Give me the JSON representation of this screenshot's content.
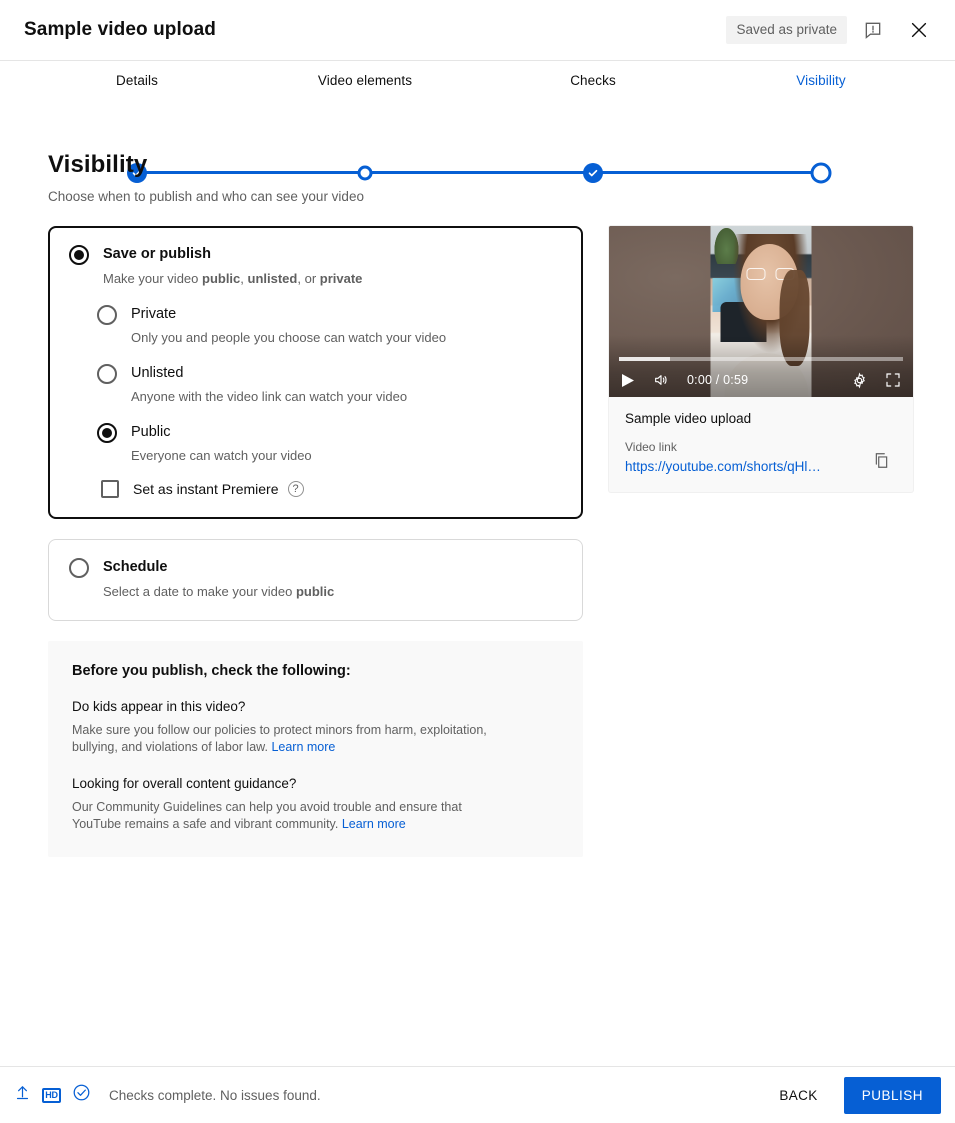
{
  "header": {
    "title": "Sample video upload",
    "status_badge": "Saved as private",
    "feedback_icon": "feedback-exclamation-icon",
    "close_icon": "close-icon"
  },
  "stepper": {
    "steps": [
      {
        "label": "Details",
        "state": "done"
      },
      {
        "label": "Video elements",
        "state": "todo"
      },
      {
        "label": "Checks",
        "state": "done"
      },
      {
        "label": "Visibility",
        "state": "current"
      }
    ],
    "accent_color": "#065fd4"
  },
  "page": {
    "title": "Visibility",
    "subtitle": "Choose when to publish and who can see your video"
  },
  "save_or_publish": {
    "title": "Save or publish",
    "desc_prefix": "Make your video ",
    "desc_b1": "public",
    "desc_mid1": ", ",
    "desc_b2": "unlisted",
    "desc_mid2": ", or ",
    "desc_b3": "private",
    "selected": true,
    "options": [
      {
        "label": "Private",
        "desc": "Only you and people you choose can watch your video",
        "selected": false
      },
      {
        "label": "Unlisted",
        "desc": "Anyone with the video link can watch your video",
        "selected": false
      },
      {
        "label": "Public",
        "desc": "Everyone can watch your video",
        "selected": true
      }
    ],
    "premiere": {
      "label": "Set as instant Premiere",
      "checked": false,
      "help_glyph": "?"
    }
  },
  "schedule": {
    "title": "Schedule",
    "desc_prefix": "Select a date to make your video ",
    "desc_bold": "public",
    "selected": false
  },
  "checklist": {
    "title": "Before you publish, check the following:",
    "items": [
      {
        "question": "Do kids appear in this video?",
        "answer": "Make sure you follow our policies to protect minors from harm, exploitation, bullying, and violations of labor law. ",
        "link": "Learn more"
      },
      {
        "question": "Looking for overall content guidance?",
        "answer": "Our Community Guidelines can help you avoid trouble and ensure that YouTube remains a safe and vibrant community. ",
        "link": "Learn more"
      }
    ]
  },
  "preview": {
    "player": {
      "play_icon": "play-icon",
      "volume_icon": "volume-icon",
      "time": "0:00 / 0:59",
      "settings_icon": "gear-icon",
      "fullscreen_icon": "fullscreen-icon"
    },
    "video_title": "Sample video upload",
    "link_label": "Video link",
    "link_url": "https://youtube.com/shorts/qHl…",
    "copy_icon": "copy-icon"
  },
  "footer": {
    "icons": [
      "upload-icon",
      "hd-icon",
      "check-circle-icon"
    ],
    "hd_text": "HD",
    "status": "Checks complete. No issues found.",
    "back_label": "BACK",
    "publish_label": "PUBLISH",
    "publish_color": "#065fd4"
  }
}
